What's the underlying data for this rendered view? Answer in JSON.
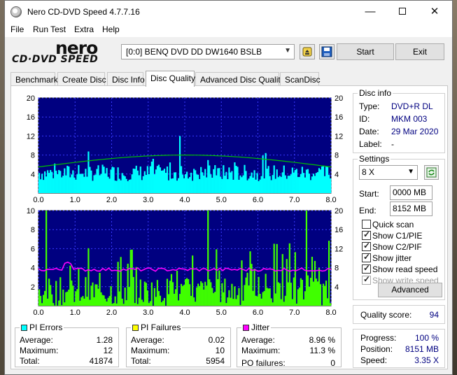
{
  "window": {
    "title": "Nero CD-DVD Speed 4.7.7.16",
    "min_icon": "minimize-icon",
    "max_icon": "maximize-icon",
    "close_icon": "close-icon"
  },
  "menu": [
    "File",
    "Run Test",
    "Extra",
    "Help"
  ],
  "toolbar": {
    "logo_top": "nero",
    "logo_bottom": "CD·DVD SPEED",
    "drive": "[0:0]   BENQ DVD DD DW1640 BSLB",
    "start_label": "Start",
    "exit_label": "Exit"
  },
  "tabs": [
    "Benchmark",
    "Create Disc",
    "Disc Info",
    "Disc Quality",
    "Advanced Disc Quality",
    "ScanDisc"
  ],
  "active_tab": "Disc Quality",
  "chart_data": [
    {
      "type": "bar",
      "name": "pi-errors-chart",
      "x_ticks": [
        "0.0",
        "1.0",
        "2.0",
        "3.0",
        "4.0",
        "5.0",
        "6.0",
        "7.0",
        "8.0"
      ],
      "y_left_ticks": [
        "20",
        "16",
        "12",
        "8",
        "4"
      ],
      "y_right_ticks": [
        "20",
        "16",
        "12",
        "8",
        "4"
      ],
      "xlim": [
        0,
        8
      ],
      "ylim": [
        0,
        20
      ],
      "series": [
        {
          "name": "PI Errors",
          "color": "#00ffff",
          "average": 1.28,
          "max": 12
        },
        {
          "name": "Read speed",
          "color": "#00c000"
        }
      ],
      "grid": true,
      "plot_bg": "#000080"
    },
    {
      "type": "bar",
      "name": "pi-failures-jitter-chart",
      "x_ticks": [
        "0.0",
        "1.0",
        "2.0",
        "3.0",
        "4.0",
        "5.0",
        "6.0",
        "7.0",
        "8.0"
      ],
      "y_left_ticks": [
        "10",
        "8",
        "6",
        "4",
        "2"
      ],
      "y_right_ticks": [
        "20",
        "16",
        "12",
        "8",
        "4"
      ],
      "xlim": [
        0,
        8
      ],
      "ylim": [
        0,
        10
      ],
      "series": [
        {
          "name": "PI Failures",
          "color": "#40ff00",
          "average": 0.02,
          "max": 10
        },
        {
          "name": "Jitter",
          "color": "#ff00ff",
          "average": 8.96
        }
      ],
      "grid": true,
      "plot_bg": "#000080"
    }
  ],
  "stats": {
    "pi_errors": {
      "title": "PI Errors",
      "color": "#00ffff",
      "average_label": "Average:",
      "average": "1.28",
      "maximum_label": "Maximum:",
      "maximum": "12",
      "total_label": "Total:",
      "total": "41874"
    },
    "pi_failures": {
      "title": "PI Failures",
      "color": "#ffff00",
      "average_label": "Average:",
      "average": "0.02",
      "maximum_label": "Maximum:",
      "maximum": "10",
      "total_label": "Total:",
      "total": "5954"
    },
    "jitter": {
      "title": "Jitter",
      "color": "#ff00ff",
      "average_label": "Average:",
      "average": "8.96 %",
      "maximum_label": "Maximum:",
      "maximum": "11.3 %",
      "po_label": "PO failures:",
      "po": "0"
    }
  },
  "disc_info": {
    "title": "Disc info",
    "type_label": "Type:",
    "type": "DVD+R DL",
    "id_label": "ID:",
    "id": "MKM 003",
    "date_label": "Date:",
    "date": "29 Mar 2020",
    "label_label": "Label:",
    "label": "-"
  },
  "settings": {
    "title": "Settings",
    "speed": "8 X",
    "start_label": "Start:",
    "start": "0000 MB",
    "end_label": "End:",
    "end": "8152 MB",
    "checks": [
      {
        "label": "Quick scan",
        "checked": false,
        "enabled": true
      },
      {
        "label": "Show C1/PIE",
        "checked": true,
        "enabled": true
      },
      {
        "label": "Show C2/PIF",
        "checked": true,
        "enabled": true
      },
      {
        "label": "Show jitter",
        "checked": true,
        "enabled": true
      },
      {
        "label": "Show read speed",
        "checked": true,
        "enabled": true
      },
      {
        "label": "Show write speed",
        "checked": true,
        "enabled": false
      }
    ],
    "advanced_label": "Advanced"
  },
  "quality": {
    "label": "Quality score:",
    "value": "94"
  },
  "progress": {
    "progress_label": "Progress:",
    "progress": "100 %",
    "position_label": "Position:",
    "position": "8151 MB",
    "speed_label": "Speed:",
    "speed": "3.35 X"
  }
}
